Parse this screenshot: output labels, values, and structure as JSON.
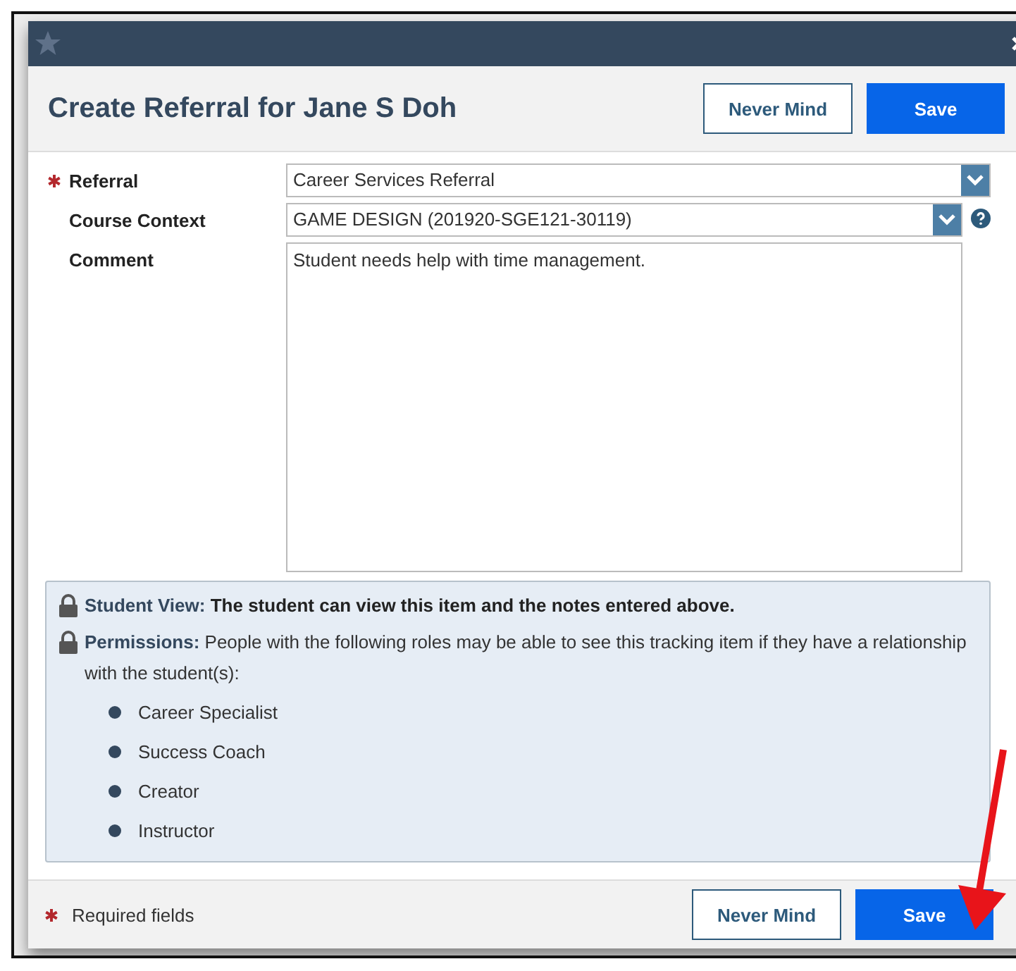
{
  "dialog": {
    "title": "Create Referral for Jane S Doh",
    "header_buttons": [
      {
        "label": "Never Mind",
        "kind": "secondary"
      },
      {
        "label": "Save",
        "kind": "primary"
      }
    ]
  },
  "fields": [
    {
      "label": "Referral",
      "kind": "select",
      "required": true,
      "value": "Career Services Referral",
      "help": false
    },
    {
      "label": "Course Context",
      "kind": "select",
      "required": false,
      "value": "GAME DESIGN (201920-SGE121-30119)",
      "help": true
    },
    {
      "label": "Comment",
      "kind": "textarea",
      "required": false,
      "value": "Student needs help with time management.",
      "help": false
    }
  ],
  "info": {
    "student_view": {
      "label": "Student View:",
      "text": "The student can view this item and the notes entered above."
    },
    "permissions": {
      "label": "Permissions:",
      "text": "People with the following roles may be able to see this tracking item if they have a relationship with the student(s):"
    },
    "roles": [
      "Career Specialist",
      "Success Coach",
      "Creator",
      "Instructor"
    ]
  },
  "footer": {
    "required_note": "Required fields",
    "buttons": [
      {
        "label": "Never Mind",
        "kind": "secondary"
      },
      {
        "label": "Save",
        "kind": "primary"
      }
    ]
  }
}
